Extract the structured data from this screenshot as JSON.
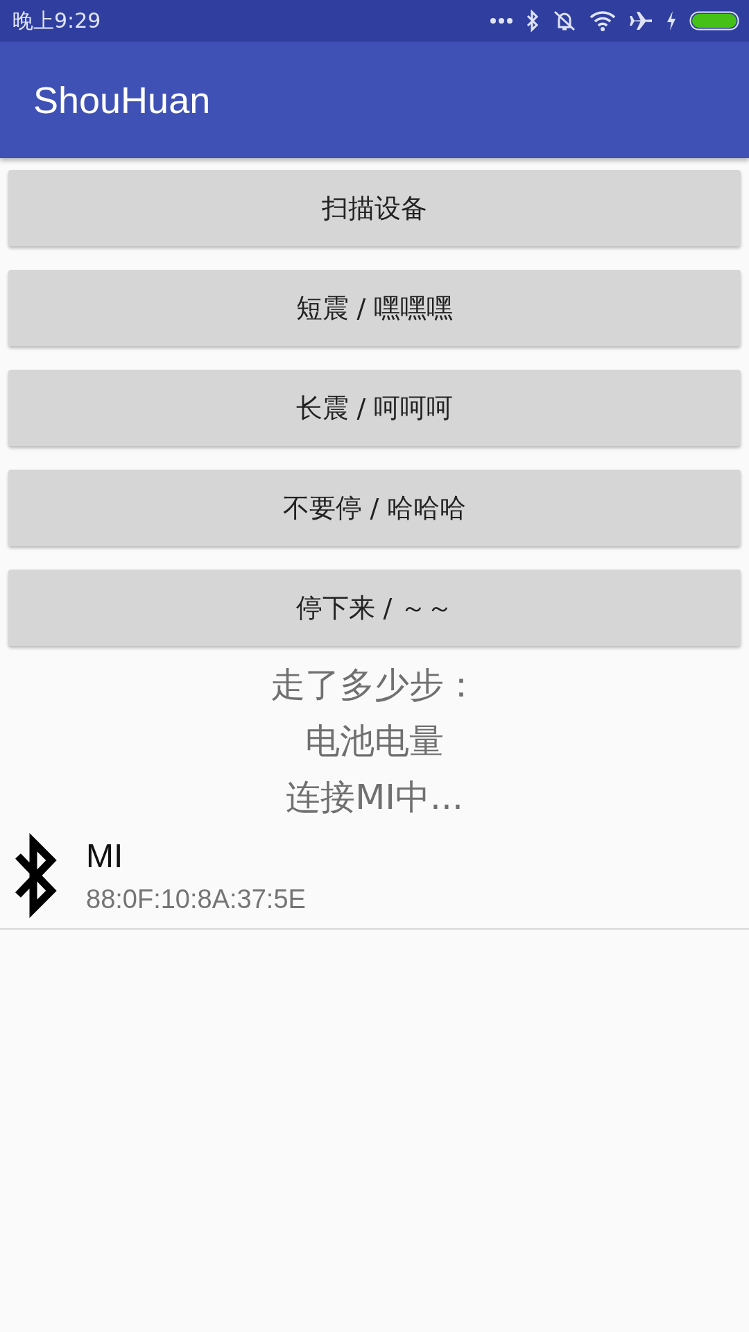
{
  "status_bar": {
    "time": "晚上9:29"
  },
  "app_bar": {
    "title": "ShouHuan"
  },
  "buttons": [
    "扫描设备",
    "短震 / 嘿嘿嘿",
    "长震 / 呵呵呵",
    "不要停 / 哈哈哈",
    "停下来 / ～～"
  ],
  "info_lines": [
    "走了多少步：",
    "电池电量",
    "连接MI中..."
  ],
  "devices": [
    {
      "name": "MI",
      "address": "88:0F:10:8A:37:5E"
    }
  ]
}
